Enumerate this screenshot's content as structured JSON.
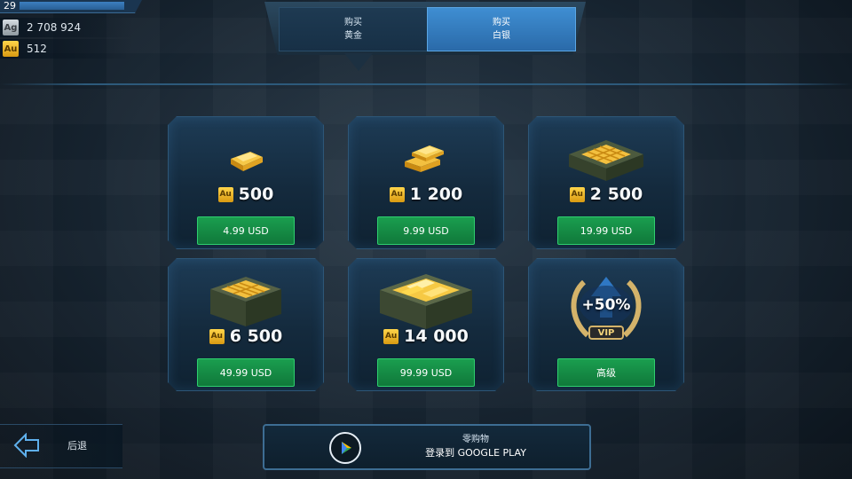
{
  "player": {
    "level": "29",
    "silver": {
      "label": "Ag",
      "value": "2 708 924"
    },
    "gold": {
      "label": "Au",
      "value": "512"
    }
  },
  "tabs": [
    {
      "line1": "购买",
      "line2": "黄金"
    },
    {
      "line1": "购买",
      "line2": "白银"
    }
  ],
  "offers": [
    {
      "currency": "Au",
      "amount": "500",
      "button": "4.99 USD",
      "icon": "gold-bar-icon"
    },
    {
      "currency": "Au",
      "amount": "1 200",
      "button": "9.99 USD",
      "icon": "gold-bars-stack-icon"
    },
    {
      "currency": "Au",
      "amount": "2 500",
      "button": "19.99 USD",
      "icon": "gold-crate-icon"
    },
    {
      "currency": "Au",
      "amount": "6 500",
      "button": "49.99 USD",
      "icon": "gold-box-icon"
    },
    {
      "currency": "Au",
      "amount": "14 000",
      "button": "99.99 USD",
      "icon": "treasure-chest-icon"
    },
    {
      "badge": "+50%",
      "badge_sub": "VIP",
      "button": "高级",
      "icon": "vip-laurel-icon"
    }
  ],
  "footer": {
    "back_label": "后退",
    "store_line1": "零购物",
    "store_line2": "登录到 GOOGLE PLAY"
  },
  "colors": {
    "accent_blue": "#3f8ed2",
    "buy_green": "#1a9e4f",
    "gold": "#ffd54a"
  }
}
